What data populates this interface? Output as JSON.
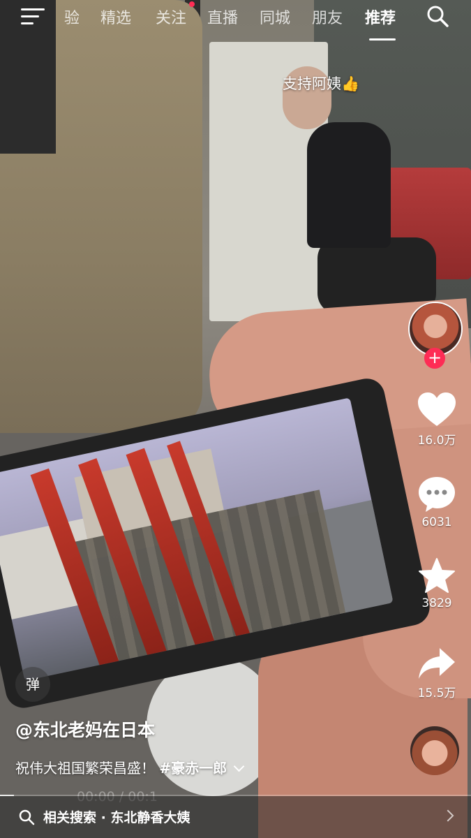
{
  "nav": {
    "tabs": [
      {
        "label": "验",
        "active": false
      },
      {
        "label": "精选",
        "active": false
      },
      {
        "label": "关注",
        "active": false
      },
      {
        "label": "直播",
        "active": false
      },
      {
        "label": "同城",
        "active": false
      },
      {
        "label": "朋友",
        "active": false
      },
      {
        "label": "推荐",
        "active": true
      }
    ],
    "menu_icon": "hamburger-menu-icon",
    "search_icon": "search-icon"
  },
  "overlay_comment": "支持阿姨👍",
  "actions": {
    "likes": "16.0万",
    "comments": "6031",
    "favorites": "3829",
    "shares": "15.5万",
    "follow_symbol": "+"
  },
  "video": {
    "danmu_label": "弹",
    "author": "@东北老妈在日本",
    "caption": "祝伟大祖国繁荣昌盛！",
    "hashtag": "#豪赤一郎",
    "timecode": "00:00 / 00:1",
    "progress": 0.03
  },
  "related_search": {
    "label": "相关搜索 · 东北静香大姨"
  },
  "colors": {
    "accent": "#fe2c55",
    "text": "#ffffff"
  }
}
